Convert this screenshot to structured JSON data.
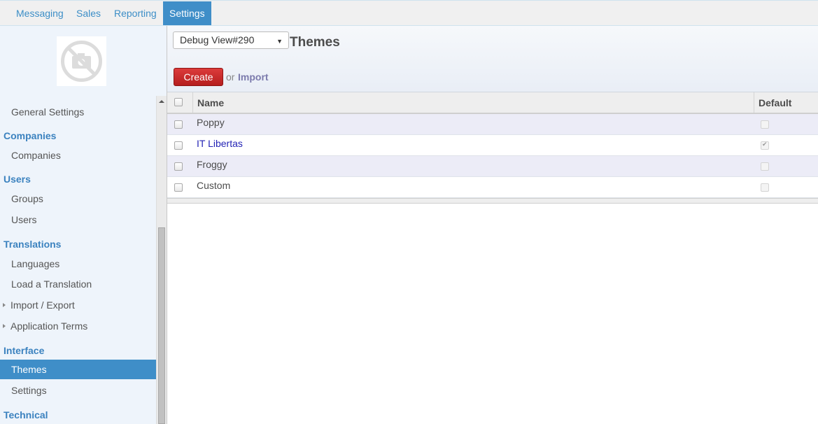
{
  "top_menu": {
    "items": [
      {
        "label": "Messaging"
      },
      {
        "label": "Sales"
      },
      {
        "label": "Reporting"
      },
      {
        "label": "Settings",
        "active": true
      }
    ]
  },
  "sidebar": {
    "logo_icon": "no-camera-icon",
    "general_settings": "General Settings",
    "sections": {
      "companies": {
        "title": "Companies",
        "items": [
          "Companies"
        ]
      },
      "users": {
        "title": "Users",
        "items": [
          "Groups",
          "Users"
        ]
      },
      "translations": {
        "title": "Translations",
        "items": [
          "Languages",
          "Load a Translation",
          "Import / Export",
          "Application Terms"
        ]
      },
      "interface": {
        "title": "Interface",
        "items": [
          "Themes",
          "Settings"
        ]
      },
      "technical": {
        "title": "Technical"
      }
    },
    "active_item": "Themes"
  },
  "header": {
    "view_select": "Debug View#290",
    "title": "Themes",
    "create_label": "Create",
    "or_label": "or",
    "import_label": "Import"
  },
  "table": {
    "columns": [
      "Name",
      "Default"
    ],
    "rows": [
      {
        "name": "Poppy",
        "default": false
      },
      {
        "name": "IT Libertas",
        "default": true
      },
      {
        "name": "Froggy",
        "default": false
      },
      {
        "name": "Custom",
        "default": false
      }
    ]
  },
  "colors": {
    "accent": "#3f8ec8",
    "create_button": "#c62828",
    "section_title": "#3b82bf",
    "link": "#2424b5"
  }
}
